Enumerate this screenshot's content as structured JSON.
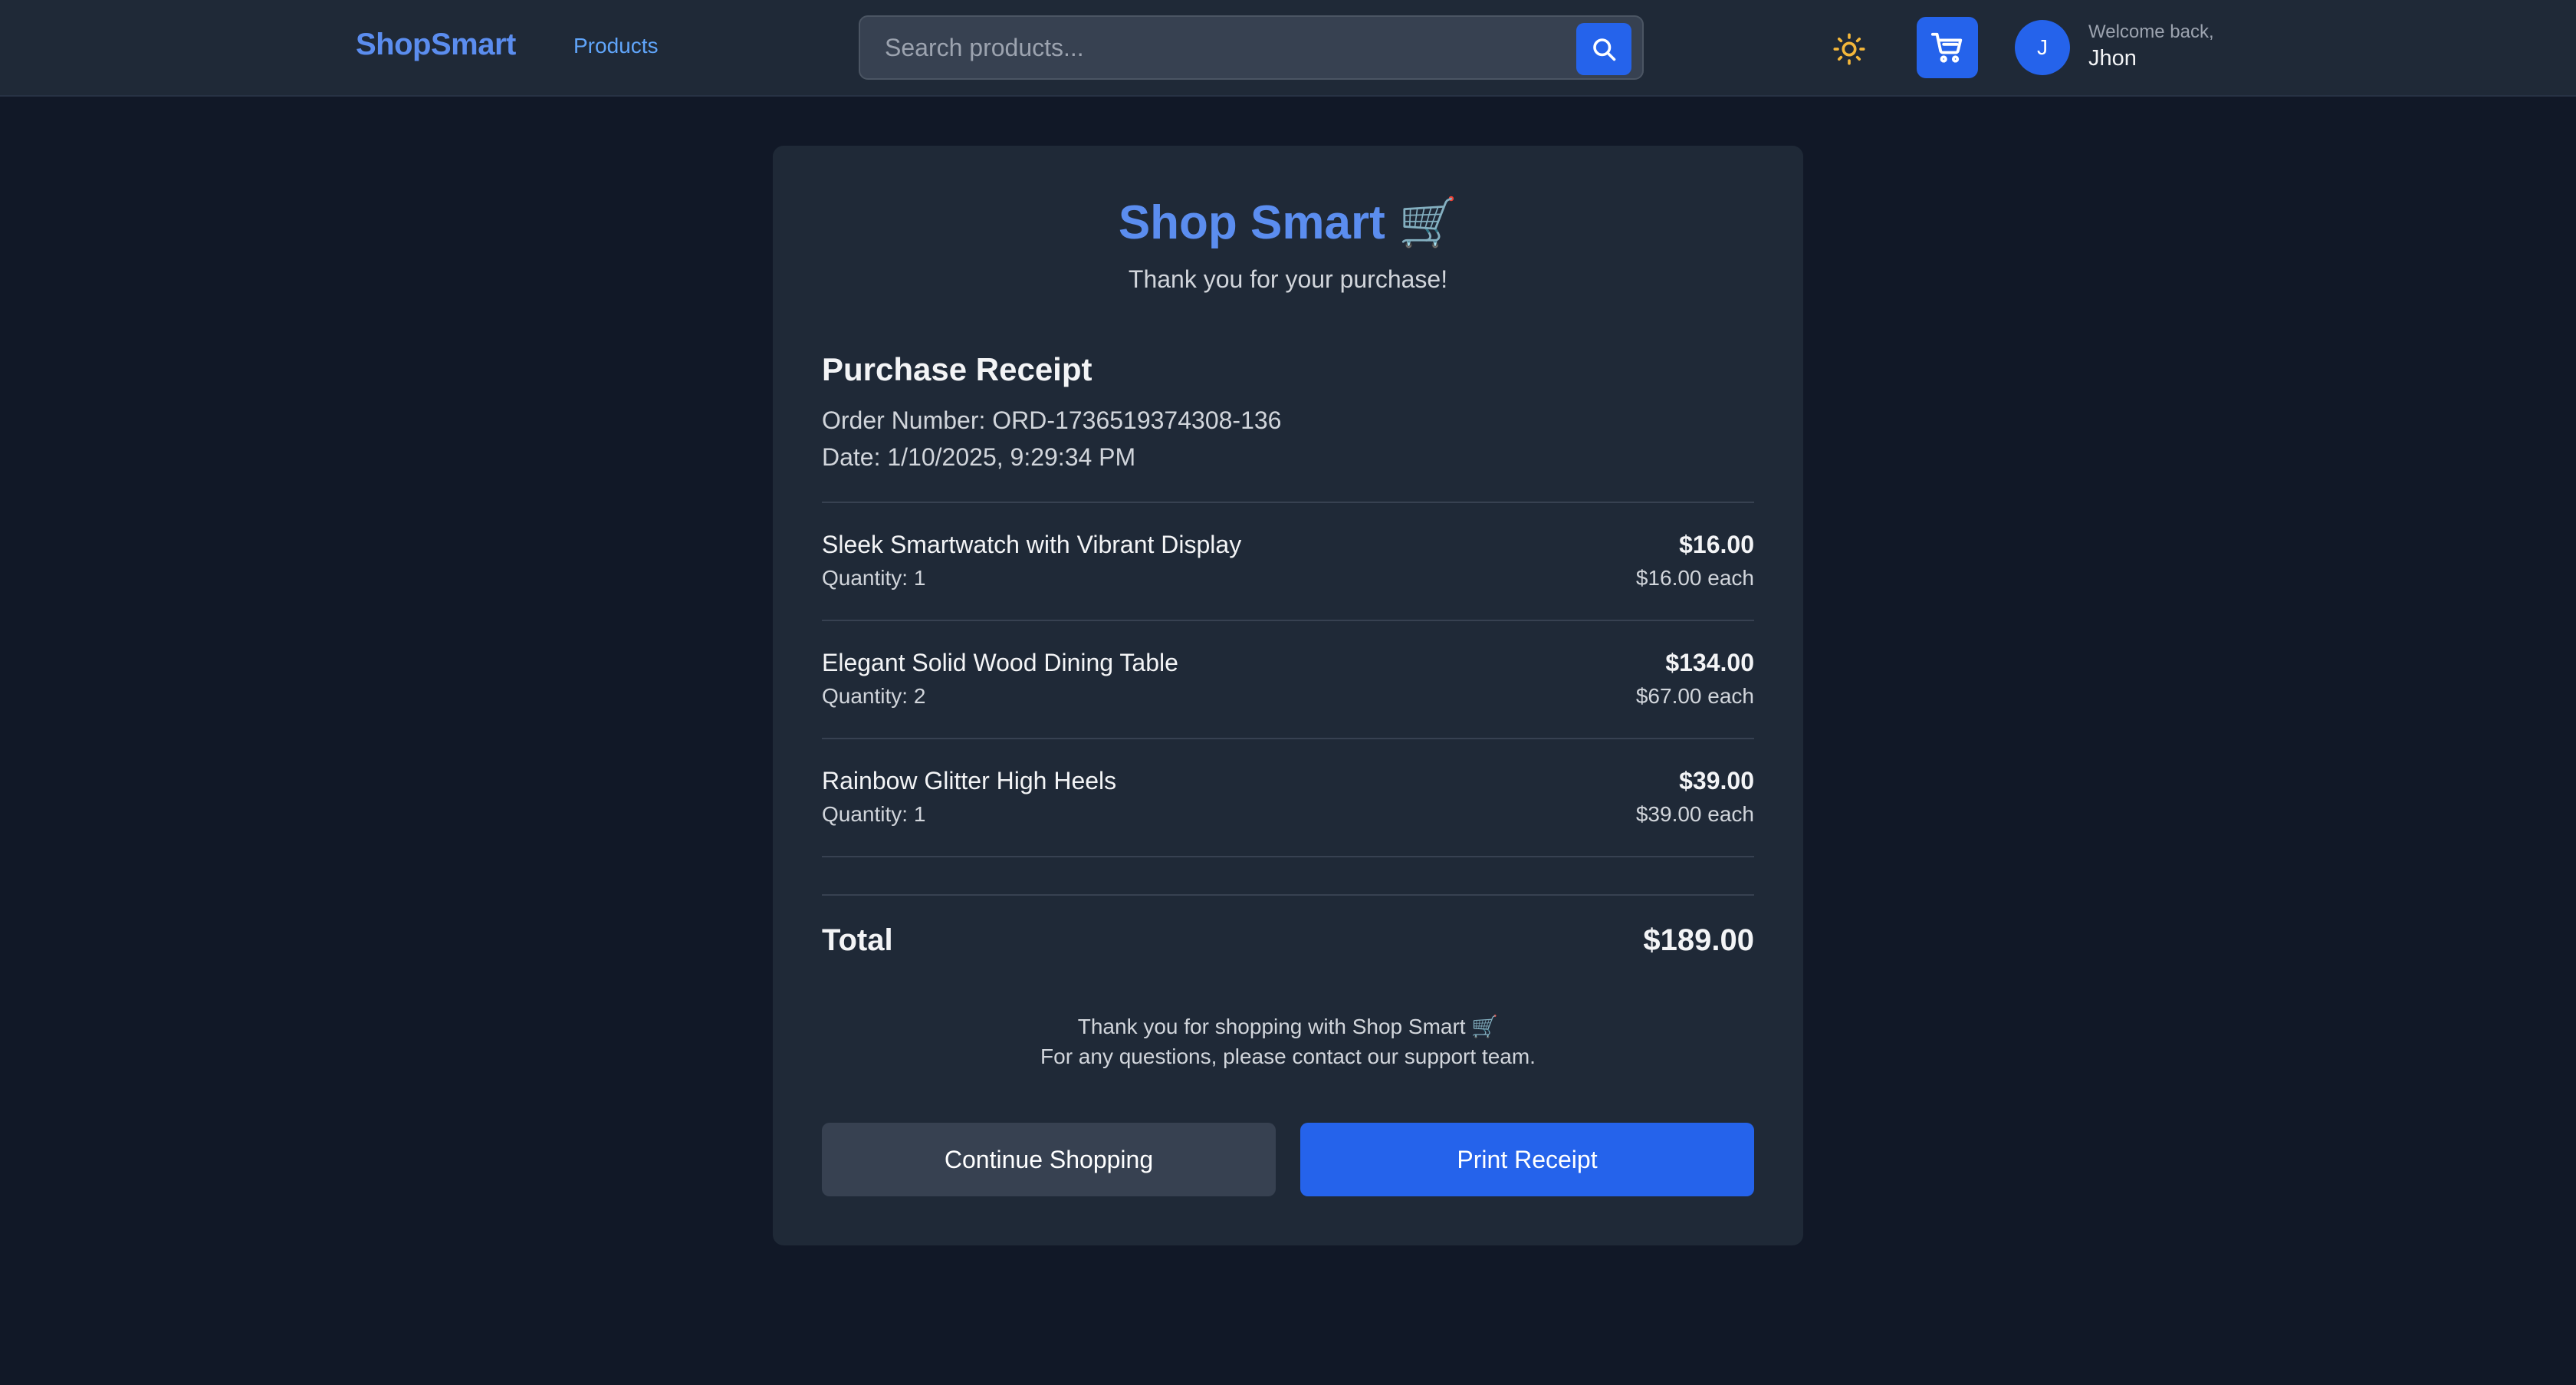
{
  "header": {
    "brand": "ShopSmart",
    "nav_products": "Products",
    "search_placeholder": "Search products...",
    "search_icon": "search-icon",
    "theme_icon": "sun-icon",
    "cart_icon": "cart-icon",
    "user_initial": "J",
    "welcome_text": "Welcome back,",
    "user_name": "Jhon"
  },
  "receipt": {
    "shop_title": "Shop Smart",
    "shop_emoji": "🛒",
    "thanks": "Thank you for your purchase!",
    "heading": "Purchase Receipt",
    "order_number": "Order Number: ORD-1736519374308-136",
    "date": "Date: 1/10/2025, 9:29:34 PM",
    "items": [
      {
        "name": "Sleek Smartwatch with Vibrant Display",
        "quantity": "Quantity: 1",
        "total": "$16.00",
        "each": "$16.00 each"
      },
      {
        "name": "Elegant Solid Wood Dining Table",
        "quantity": "Quantity: 2",
        "total": "$134.00",
        "each": "$67.00 each"
      },
      {
        "name": "Rainbow Glitter High Heels",
        "quantity": "Quantity: 1",
        "total": "$39.00",
        "each": "$39.00 each"
      }
    ],
    "total_label": "Total",
    "total_value": "$189.00",
    "footer_line1": "Thank you for shopping with Shop Smart",
    "footer_emoji": "🛒",
    "footer_line2": "For any questions, please contact our support team.",
    "continue_label": "Continue Shopping",
    "print_label": "Print Receipt"
  },
  "colors": {
    "page_bg": "#111827",
    "surface": "#1f2937",
    "accent": "#2563eb",
    "brand_text": "#5b8def",
    "sun": "#f4b73a"
  }
}
